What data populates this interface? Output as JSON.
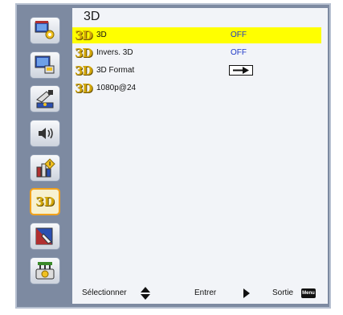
{
  "sidebar": {
    "items": [
      {
        "id": "image",
        "icon": "picture-settings-icon"
      },
      {
        "id": "display",
        "icon": "display-settings-icon"
      },
      {
        "id": "setup",
        "icon": "setup-icon"
      },
      {
        "id": "volume",
        "icon": "volume-icon"
      },
      {
        "id": "options",
        "icon": "options-icon"
      },
      {
        "id": "3d",
        "icon": "3d-icon",
        "label": "3D",
        "active": true
      },
      {
        "id": "lamp",
        "icon": "lamp-icon"
      },
      {
        "id": "network",
        "icon": "network-icon"
      }
    ]
  },
  "panel": {
    "title": "3D",
    "rows": [
      {
        "logo": "3D",
        "label": "3D",
        "value": "OFF",
        "selected": true
      },
      {
        "logo": "3D",
        "label": "Invers. 3D",
        "value": "OFF"
      },
      {
        "logo": "3D",
        "label": "3D Format",
        "value_icon": "right-arrow-icon"
      },
      {
        "logo": "3D",
        "label": "1080p@24"
      }
    ]
  },
  "footer": {
    "select_label": "Sélectionner",
    "enter_label": "Entrer",
    "exit_label": "Sortie",
    "menu_key": "Menu"
  },
  "colors": {
    "frame": "#7d8aa1",
    "panel": "#f2f4f8",
    "selected_row": "#ffff00",
    "value_text": "#1f39c6",
    "active_border": "#f2a21c"
  }
}
